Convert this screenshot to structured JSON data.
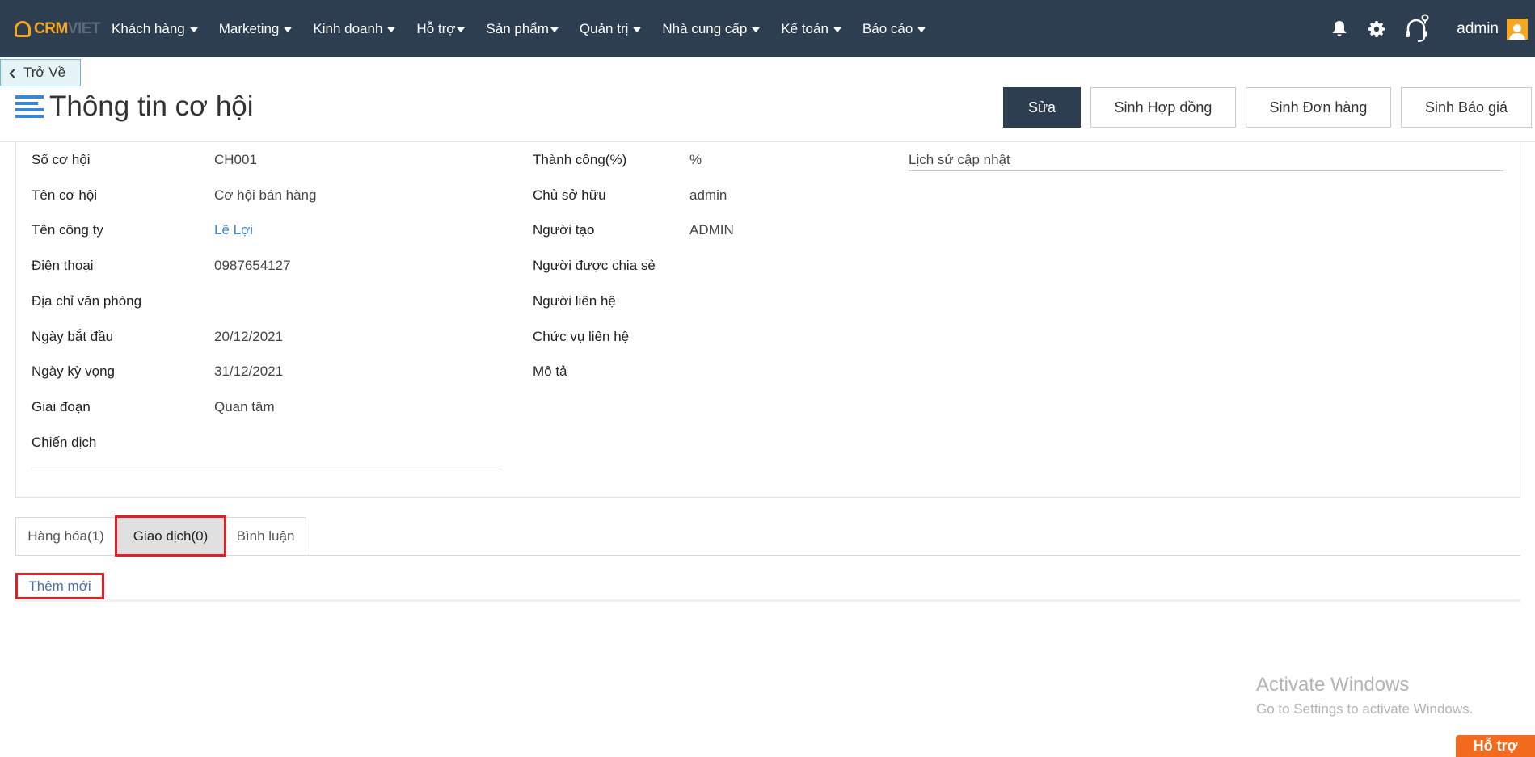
{
  "brand": {
    "logo_left": "CRM",
    "logo_right": "VIET"
  },
  "nav": {
    "menu": [
      {
        "label": "Khách hàng"
      },
      {
        "label": "Marketing"
      },
      {
        "label": "Kinh doanh"
      },
      {
        "label": "Hỗ trợ"
      },
      {
        "label": "Sản phẩm"
      },
      {
        "label": "Quản trị"
      },
      {
        "label": "Nhà cung cấp"
      },
      {
        "label": "Kế toán"
      },
      {
        "label": "Báo cáo"
      }
    ],
    "icons": [
      "bell-icon",
      "gear-icon",
      "headset-icon"
    ],
    "user": "admin"
  },
  "back_label": "Trở Về",
  "page": {
    "title": "Thông tin cơ hội"
  },
  "actions": {
    "edit": "Sửa",
    "gen_contract": "Sinh Hợp đồng",
    "gen_order": "Sinh Đơn hàng",
    "gen_quote": "Sinh Báo giá"
  },
  "details": {
    "left": [
      {
        "label": "Số cơ hội",
        "value": "CH001"
      },
      {
        "label": "Tên cơ hội",
        "value": "Cơ hội bán hàng"
      },
      {
        "label": "Tên công ty",
        "value": "Lê Lợi"
      },
      {
        "label": "Điện thoại",
        "value": "0987654127"
      },
      {
        "label": "Địa chỉ văn phòng",
        "value": ""
      },
      {
        "label": "Ngày bắt đầu",
        "value": "20/12/2021"
      },
      {
        "label": "Ngày kỳ vọng",
        "value": "31/12/2021"
      },
      {
        "label": "Giai đoạn",
        "value": "Quan tâm"
      },
      {
        "label": "Chiến dịch",
        "value": ""
      }
    ],
    "right": [
      {
        "label": "Thành công(%)",
        "value": "%"
      },
      {
        "label": "Chủ sở hữu",
        "value": "admin"
      },
      {
        "label": "Người tạo",
        "value": "ADMIN"
      },
      {
        "label": "Người được chia sẻ",
        "value": ""
      },
      {
        "label": "Người liên hệ",
        "value": ""
      },
      {
        "label": "Chức vụ liên hệ",
        "value": ""
      },
      {
        "label": "Mô tả",
        "value": ""
      }
    ],
    "history_title": "Lịch sử cập nhật"
  },
  "tabs": [
    {
      "label": "Hàng hóa(1)"
    },
    {
      "label": "Giao dịch(0)"
    },
    {
      "label": "Bình luận"
    }
  ],
  "add_new_label": "Thêm mới",
  "watermark": {
    "line1": "Activate Windows",
    "line2": "Go to Settings to activate Windows."
  },
  "support_label": "Hỗ trợ",
  "colors": {
    "nav_bg": "#2d3e50",
    "brand_orange": "#f5a623",
    "link_blue": "#3b86d9",
    "highlight_red": "#e31e24",
    "support_orange": "#f26b1d"
  }
}
